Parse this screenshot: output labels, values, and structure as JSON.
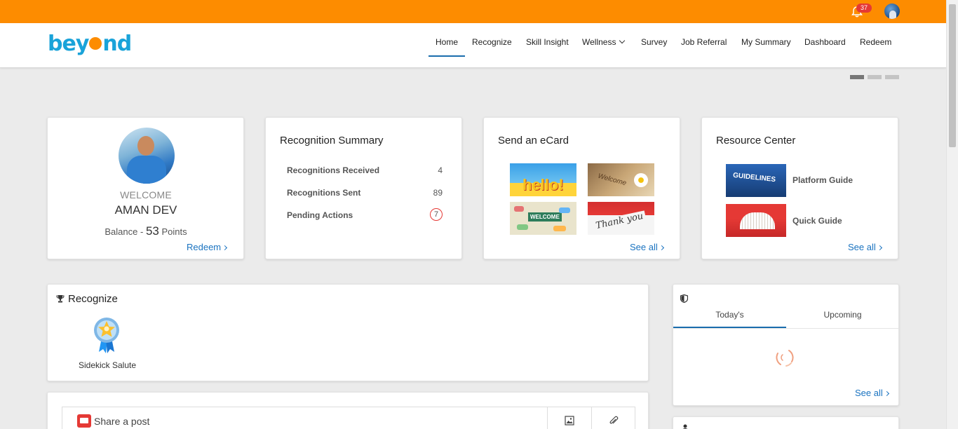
{
  "topbar": {
    "notification_count": "37",
    "bell_icon": "bell-icon",
    "avatar_icon": "user-avatar"
  },
  "header": {
    "logo_text_left": "bey",
    "logo_text_right": "nd",
    "nav": [
      {
        "label": "Home",
        "active": true
      },
      {
        "label": "Recognize"
      },
      {
        "label": "Skill Insight"
      },
      {
        "label": "Wellness",
        "has_dropdown": true
      },
      {
        "label": "Survey"
      },
      {
        "label": "Job Referral"
      },
      {
        "label": "My Summary"
      },
      {
        "label": "Dashboard"
      },
      {
        "label": "Redeem"
      }
    ]
  },
  "slider": {
    "pages": 3,
    "active_index": 0
  },
  "profile": {
    "welcome": "WELCOME",
    "name": "AMAN DEV",
    "balance_prefix": "Balance - ",
    "balance_points": "53",
    "balance_suffix": " Points",
    "redeem_link": "Redeem"
  },
  "recognition_summary": {
    "title": "Recognition Summary",
    "rows": [
      {
        "label": "Recognitions Received",
        "value": "4"
      },
      {
        "label": "Recognitions Sent",
        "value": "89"
      },
      {
        "label": "Pending Actions",
        "value": "7"
      }
    ]
  },
  "ecard": {
    "title": "Send an eCard",
    "cards": [
      {
        "text": "hello!"
      },
      {
        "text": "Welcome"
      },
      {
        "text": "WELCOME"
      },
      {
        "text": "Thank you"
      }
    ],
    "see_all": "See all"
  },
  "resource_center": {
    "title": "Resource Center",
    "items": [
      {
        "label": "Platform Guide",
        "image_text": "GUIDELINES"
      },
      {
        "label": "Quick Guide"
      }
    ],
    "see_all": "See all"
  },
  "recognize": {
    "title": "Recognize",
    "badge_label": "Sidekick Salute"
  },
  "events": {
    "tabs": [
      "Today's",
      "Upcoming"
    ],
    "active_tab": 0,
    "see_all": "See all"
  },
  "post": {
    "placeholder": "Share a post"
  },
  "colors": {
    "topbar": "#fd8c00",
    "accent": "#1a6dad",
    "link": "#1a73c0",
    "badge": "#e53935"
  }
}
